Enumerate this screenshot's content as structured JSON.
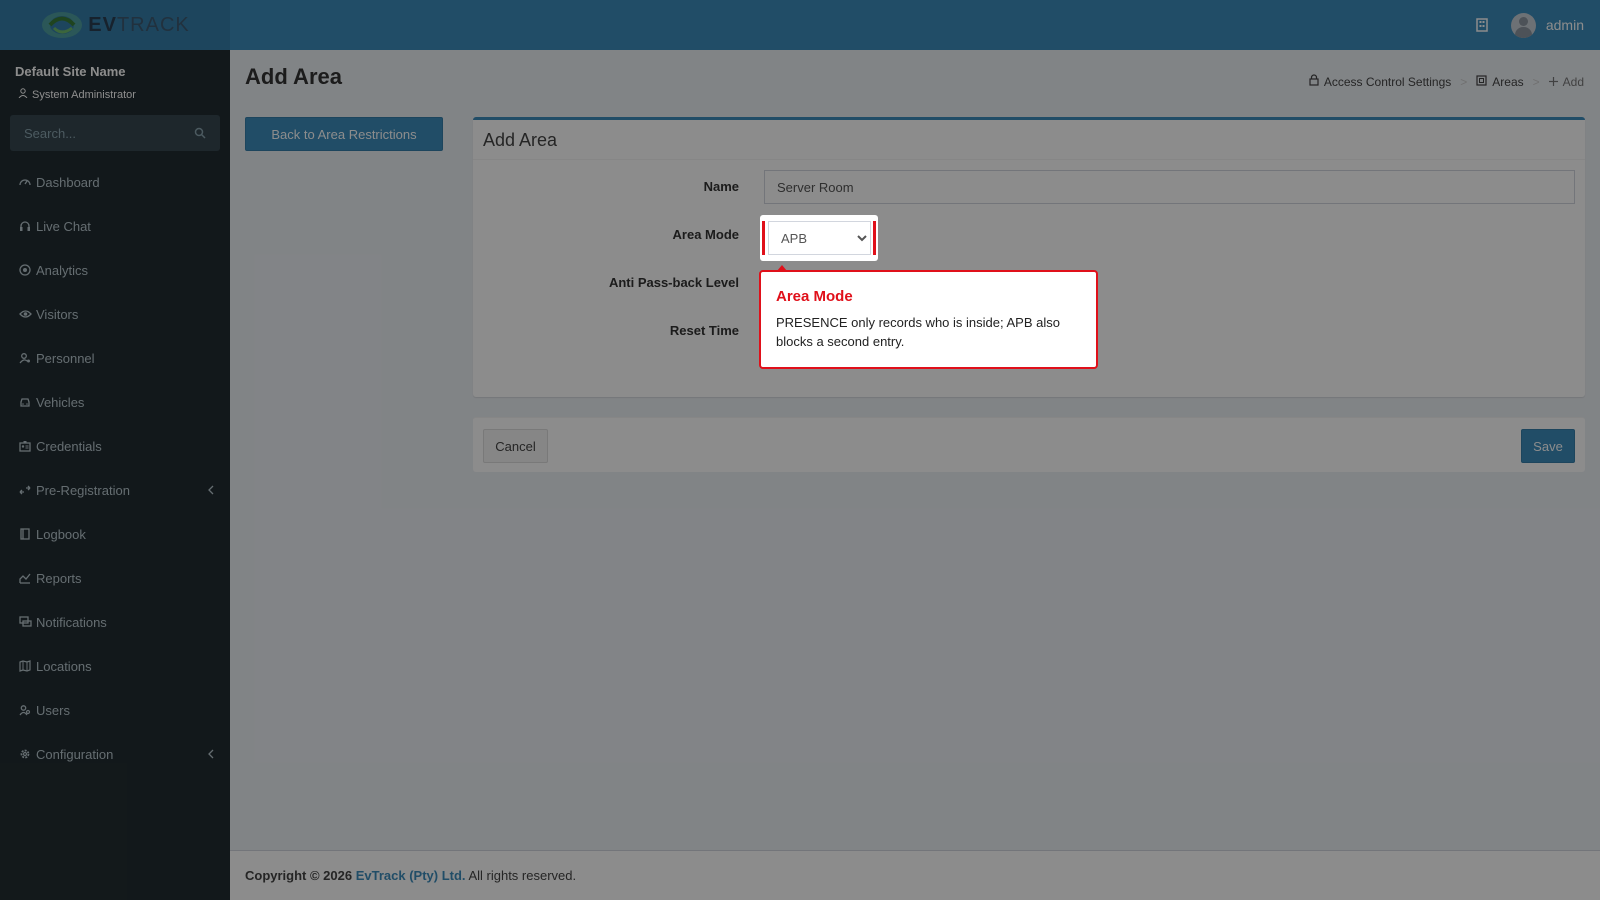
{
  "brand": {
    "ev": "EV",
    "track": "TRACK"
  },
  "topbar": {
    "user": "admin"
  },
  "sidebar": {
    "site_name": "Default Site Name",
    "role": "System Administrator",
    "search_placeholder": "Search...",
    "items": [
      {
        "label": "Dashboard",
        "icon": "dashboard-icon"
      },
      {
        "label": "Live Chat",
        "icon": "headset-icon"
      },
      {
        "label": "Analytics",
        "icon": "target-icon"
      },
      {
        "label": "Visitors",
        "icon": "eye-icon"
      },
      {
        "label": "Personnel",
        "icon": "user-gear-icon"
      },
      {
        "label": "Vehicles",
        "icon": "car-icon"
      },
      {
        "label": "Credentials",
        "icon": "id-card-icon"
      },
      {
        "label": "Pre-Registration",
        "icon": "arrows-icon",
        "expandable": true
      },
      {
        "label": "Logbook",
        "icon": "book-icon"
      },
      {
        "label": "Reports",
        "icon": "chart-icon"
      },
      {
        "label": "Notifications",
        "icon": "chat-icon"
      },
      {
        "label": "Locations",
        "icon": "map-icon"
      },
      {
        "label": "Users",
        "icon": "users-icon"
      },
      {
        "label": "Configuration",
        "icon": "gear-icon",
        "expandable": true
      }
    ]
  },
  "page": {
    "title": "Add Area",
    "back_button": "Back to Area Restrictions",
    "breadcrumb": {
      "item1": "Access Control Settings",
      "item2": "Areas",
      "item3": "Add"
    }
  },
  "form": {
    "box_title": "Add Area",
    "name_label": "Name",
    "name_value": "Server Room",
    "area_mode_label": "Area Mode",
    "area_mode_value": "APB",
    "anti_passback_label": "Anti Pass-back Level",
    "reset_time_label": "Reset Time",
    "cancel_label": "Cancel",
    "save_label": "Save"
  },
  "tooltip": {
    "title": "Area Mode",
    "body": "PRESENCE only records who is inside; APB also blocks a second entry."
  },
  "footer": {
    "copyright": "Copyright © 2026",
    "company": "EvTrack (Pty) Ltd.",
    "rights": "All rights reserved."
  },
  "colors": {
    "accent": "#3c8dbc",
    "sidebar": "#222d32",
    "highlight": "#e0101a"
  }
}
